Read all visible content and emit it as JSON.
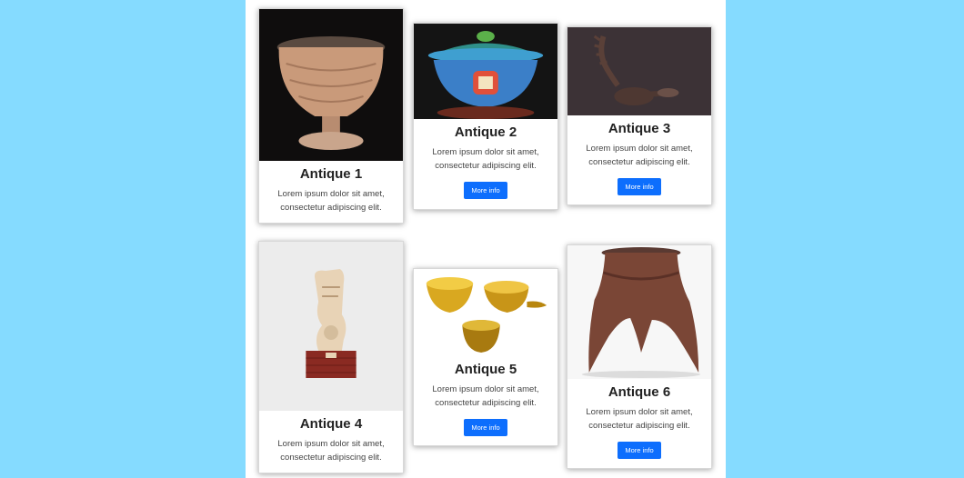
{
  "colors": {
    "background": "#85dbff",
    "accent": "#0d6efd"
  },
  "cards": [
    {
      "title": "Antique 1",
      "text": "Lorem ipsum dolor sit amet, consectetur adipiscing elit.",
      "button": ""
    },
    {
      "title": "Antique 2",
      "text": "Lorem ipsum dolor sit amet, consectetur adipiscing elit.",
      "button": "More info"
    },
    {
      "title": "Antique 3",
      "text": "Lorem ipsum dolor sit amet, consectetur adipiscing elit.",
      "button": "More info"
    },
    {
      "title": "Antique 4",
      "text": "Lorem ipsum dolor sit amet, consectetur adipiscing elit.",
      "button": ""
    },
    {
      "title": "Antique 5",
      "text": "Lorem ipsum dolor sit amet, consectetur adipiscing elit.",
      "button": "More info"
    },
    {
      "title": "Antique 6",
      "text": "Lorem ipsum dolor sit amet, consectetur adipiscing elit.",
      "button": "More info"
    }
  ]
}
